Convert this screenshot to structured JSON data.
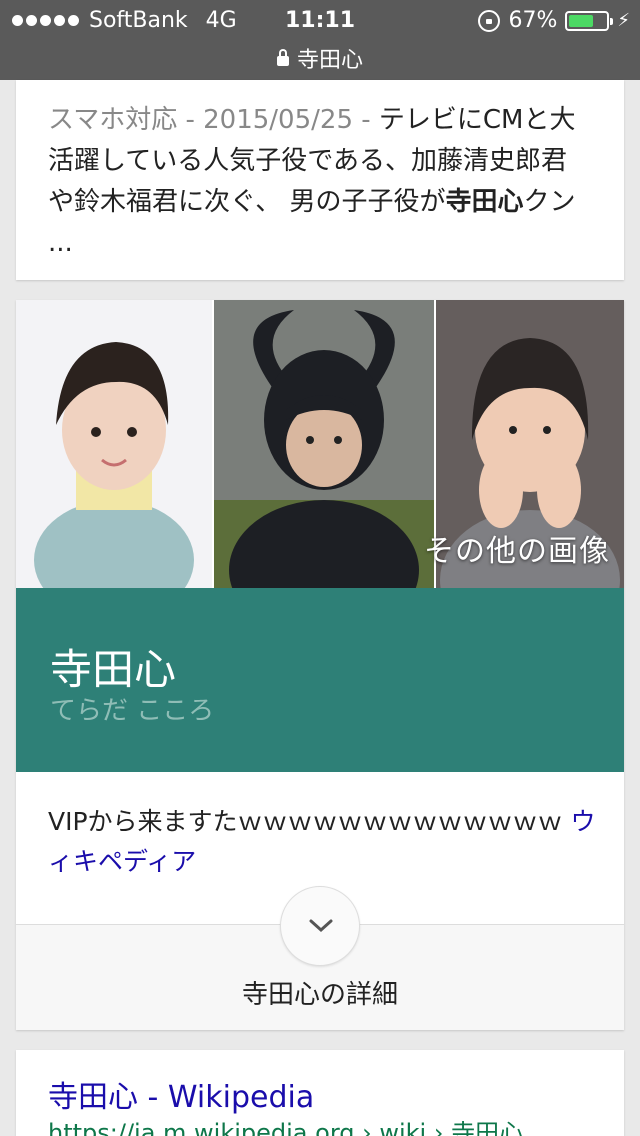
{
  "status": {
    "carrier": "SoftBank",
    "network": "4G",
    "time": "11:11",
    "battery": "67%",
    "battery_level": 0.67,
    "url": "寺田心"
  },
  "snippet": {
    "meta": "スマホ対応 - 2015/05/25 - ",
    "text1": "テレビにCMと大活躍している人気子役である、加藤清史郎君や鈴木福君に次ぐ、 男の子子役が",
    "bold": "寺田心",
    "text2": "クン ..."
  },
  "knowledge_panel": {
    "more_images": "その他の画像",
    "name": "寺田心",
    "reading": "てらだ こころ",
    "description": "VIPから来ますたｗｗｗｗｗｗｗｗｗｗｗｗｗ",
    "source_link": "ウィキペディア",
    "details": "寺田心の詳細"
  },
  "result": {
    "title": "寺田心 - Wikipedia",
    "url": "https://ja.m.wikipedia.org › wiki › 寺田心"
  }
}
